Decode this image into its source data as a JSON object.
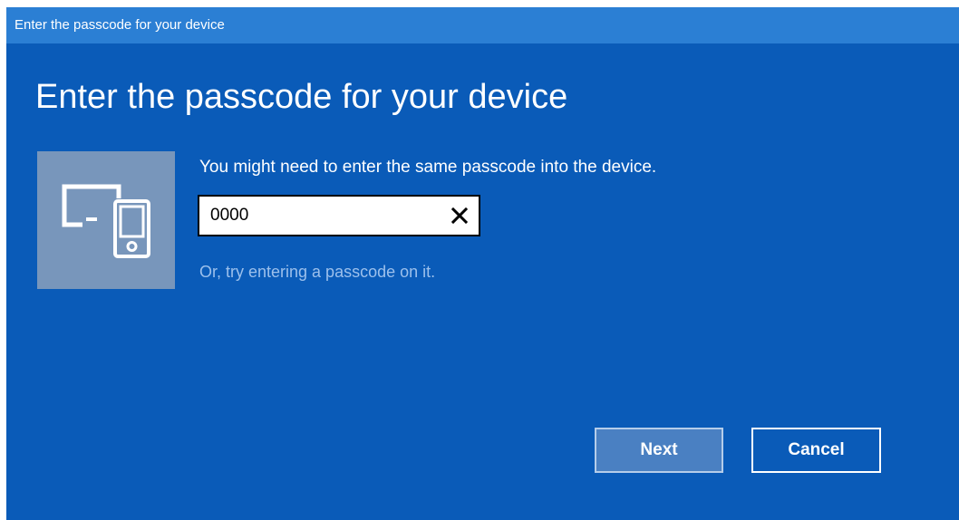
{
  "window": {
    "title": "Enter the passcode for your device"
  },
  "dialog": {
    "heading": "Enter the passcode for your device",
    "instruction": "You might need to enter the same passcode into the device.",
    "passcode": {
      "value": "0000",
      "clear_icon": "close-icon"
    },
    "alternate_hint": "Or, try entering a passcode on it.",
    "device_icon": "pc-and-phone-icon"
  },
  "buttons": {
    "next_label": "Next",
    "cancel_label": "Cancel"
  },
  "colors": {
    "background": "#0a5bb8",
    "titlebar": "#2b7fd4",
    "tile": "#7896bb",
    "hint_text": "#9cc0ec",
    "next_button": "#4a80c2"
  }
}
